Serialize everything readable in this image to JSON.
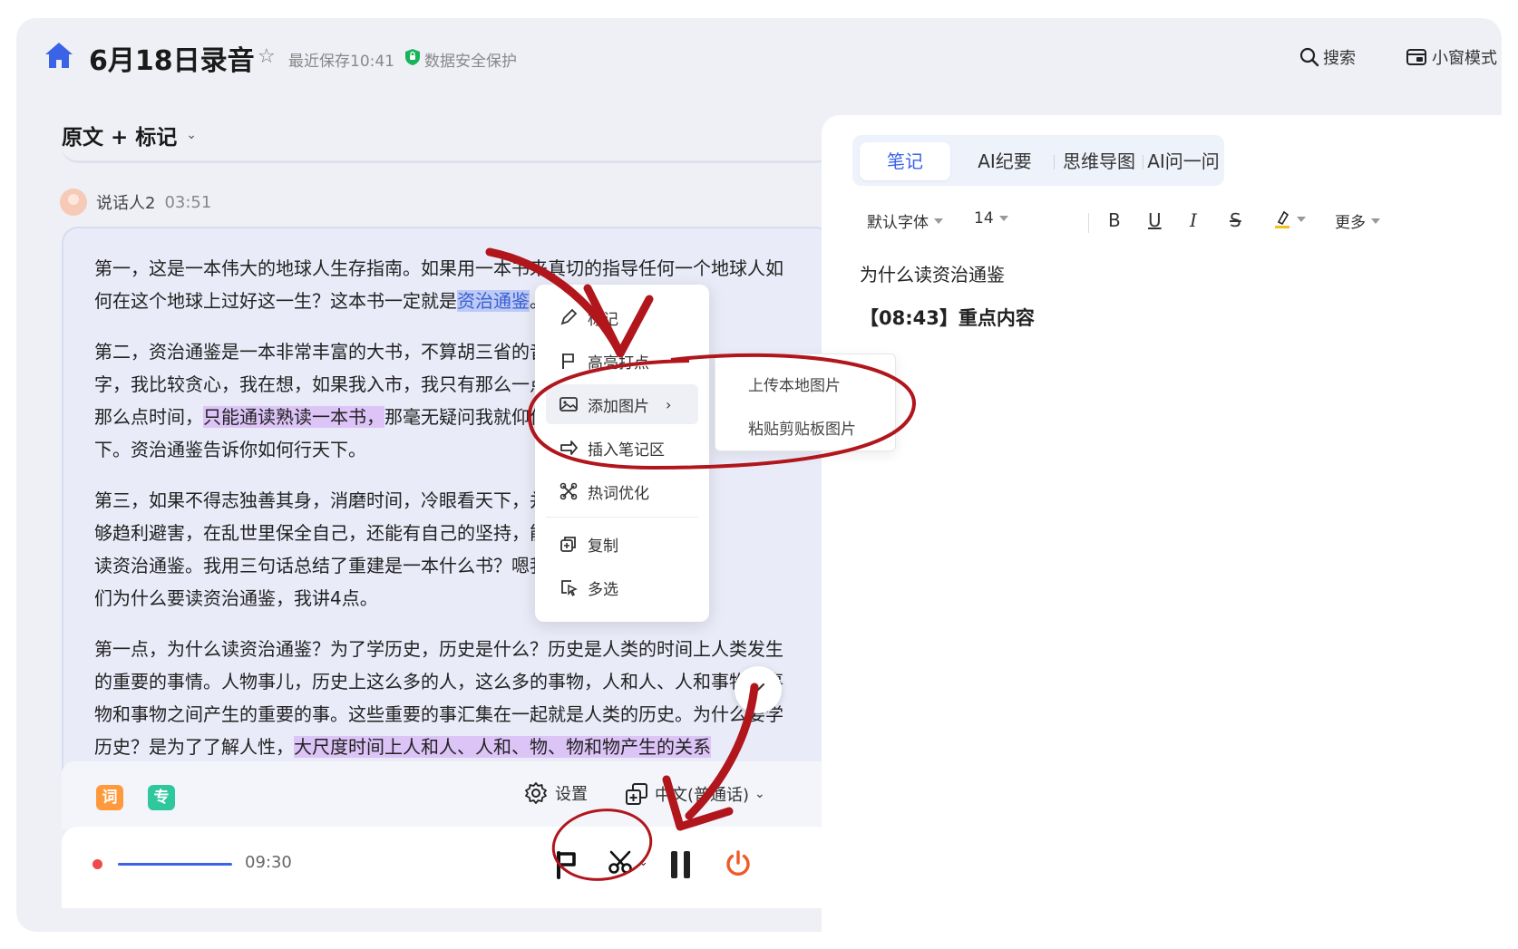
{
  "header": {
    "title": "6月18日录音",
    "save_status": "最近保存10:41",
    "security": "数据安全保护",
    "search_label": "搜索",
    "mini_mode_label": "小窗模式"
  },
  "left": {
    "mode_label": "原文 + 标记",
    "speaker": {
      "name": "说话人2",
      "time": "03:51"
    },
    "paragraphs": {
      "p1a": "第一，这是一本伟大的地球人生存指南。如果用一本书来真切的指导任何一个地球人如何在这个地球上过好这一生？这本书一定就是",
      "p1hl": "资治通鉴",
      "p1b": "。",
      "p2a": "第二，资治通鉴是一本非常丰富的大书，不算胡三省的音著",
      "p2b": "字，我比较贪心，我在想，如果我入市，我只有那么一点钱",
      "p2c": "那么点时间，",
      "p2hl": "只能通读熟读一本书，",
      "p2d": "那毫无疑问我就仰仗这",
      "p2e": "下。资治通鉴告诉你如何行天下。",
      "p3a": "第三，如果不得志独善其身，消磨时间，冷眼看天下，并且",
      "p3b": "够趋利避害，在乱世里保全自己，还能有自己的坚持，能太",
      "p3c": "读资治通鉴。我用三句话总结了重建是一本什么书？嗯我再",
      "p3d": "们为什么要读资治通鉴，我讲4点。",
      "p4a": "第一点，为什么读资治通鉴？为了学历史，历史是什么？历史是人类的时间上人类发生的重要的事情。人物事儿，历史上这么多的人，这么多的事物，人和人、人和事物、事物和事物之间产生的重要的事。这些重要的事汇集在一起就是人类的历史。为什么要学历史？是为了了解人性，",
      "p4hl": "大尺度时间上人和人、人和、物、物和物产生的关系"
    },
    "bottom_bar": {
      "tag1": "词",
      "tag2": "专",
      "settings_label": "设置",
      "language_label": "中文(普通话)"
    },
    "player": {
      "time": "09:30"
    }
  },
  "context_menu": {
    "items": [
      "标记",
      "高亮打点",
      "添加图片",
      "插入笔记区",
      "热词优化",
      "复制",
      "多选"
    ],
    "submenu": [
      "上传本地图片",
      "粘贴剪贴板图片"
    ]
  },
  "right": {
    "tabs": [
      "笔记",
      "AI纪要",
      "思维导图",
      "AI问一问"
    ],
    "toolbar": {
      "font": "默认字体",
      "size": "14",
      "bold": "B",
      "underline": "U",
      "italic": "I",
      "strike": "S",
      "more": "更多"
    },
    "note": {
      "line1": "为什么读资治通鉴",
      "line2": "【08:43】重点内容"
    }
  },
  "colors": {
    "accent": "#3a63e8",
    "highlight_blue": "#bccaf5",
    "highlight_purple": "#dcc4f7",
    "record_red": "#f04a4a",
    "power_orange": "#f05a28",
    "annotation_red": "#b0161c"
  }
}
